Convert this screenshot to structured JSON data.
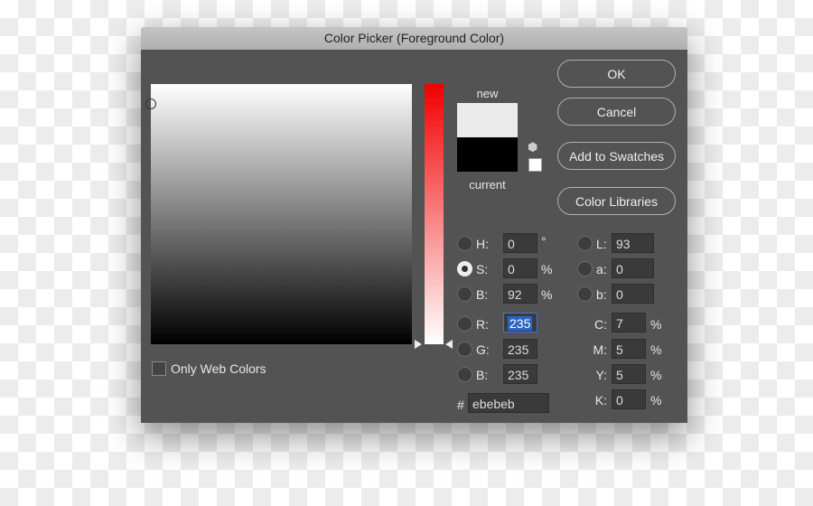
{
  "title": "Color Picker (Foreground Color)",
  "swatch": {
    "new_label": "new",
    "current_label": "current",
    "new_color": "#ebebeb",
    "current_color": "#000000"
  },
  "buttons": {
    "ok": "OK",
    "cancel": "Cancel",
    "add": "Add to Swatches",
    "libraries": "Color Libraries"
  },
  "only_web_colors": "Only Web Colors",
  "hsb": [
    {
      "label": "H:",
      "value": "0",
      "unit": "°"
    },
    {
      "label": "S:",
      "value": "0",
      "unit": "%",
      "selected": true
    },
    {
      "label": "B:",
      "value": "92",
      "unit": "%"
    }
  ],
  "rgb": [
    {
      "label": "R:",
      "value": "235"
    },
    {
      "label": "G:",
      "value": "235"
    },
    {
      "label": "B:",
      "value": "235"
    }
  ],
  "lab": [
    {
      "label": "L:",
      "value": "93"
    },
    {
      "label": "a:",
      "value": "0"
    },
    {
      "label": "b:",
      "value": "0"
    }
  ],
  "cmyk": [
    {
      "label": "C:",
      "value": "7",
      "unit": "%"
    },
    {
      "label": "M:",
      "value": "5",
      "unit": "%"
    },
    {
      "label": "Y:",
      "value": "5",
      "unit": "%"
    },
    {
      "label": "K:",
      "value": "0",
      "unit": "%"
    }
  ],
  "hex": {
    "label": "#",
    "value": "ebebeb"
  }
}
